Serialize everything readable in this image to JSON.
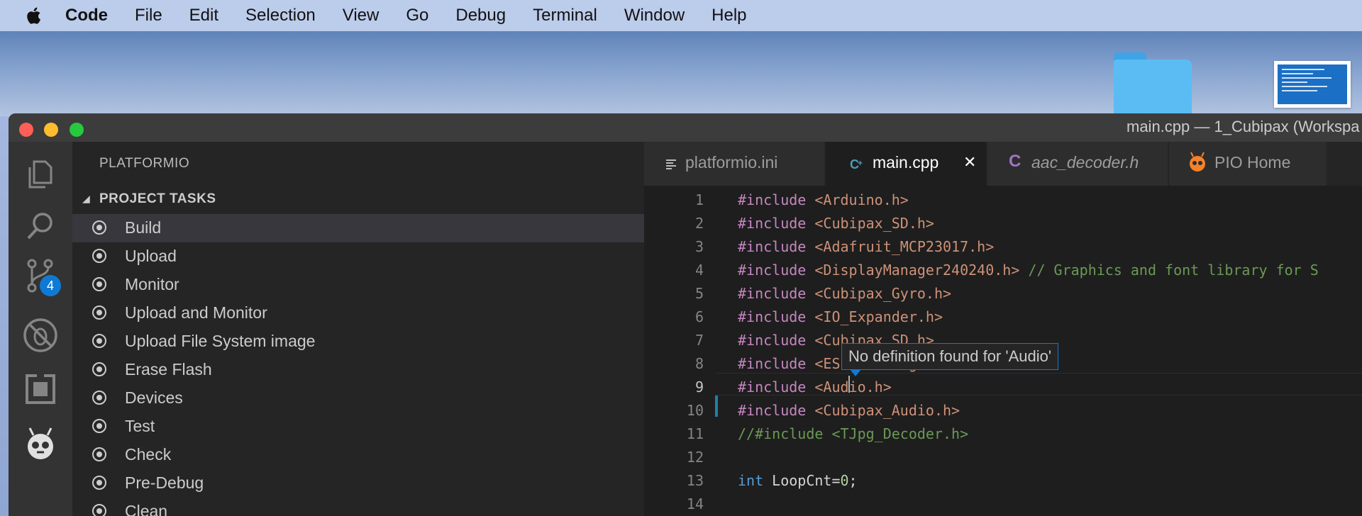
{
  "menubar": {
    "app": "Code",
    "items": [
      "File",
      "Edit",
      "Selection",
      "View",
      "Go",
      "Debug",
      "Terminal",
      "Window",
      "Help"
    ]
  },
  "window": {
    "title": "main.cpp — 1_Cubipax (Workspa"
  },
  "activity": {
    "scm_badge": "4",
    "icons": [
      "files-icon",
      "search-icon",
      "source-control-icon",
      "debug-disabled-icon",
      "extensions-icon",
      "platformio-icon"
    ]
  },
  "sidebar": {
    "title": "PLATFORMIO",
    "section": "PROJECT TASKS",
    "tasks": [
      "Build",
      "Upload",
      "Monitor",
      "Upload and Monitor",
      "Upload File System image",
      "Erase Flash",
      "Devices",
      "Test",
      "Check",
      "Pre-Debug",
      "Clean"
    ]
  },
  "tabs": [
    {
      "label": "platformio.ini",
      "icon": "lines-icon"
    },
    {
      "label": "main.cpp",
      "icon": "cpp-icon",
      "close": "✕"
    },
    {
      "label": "aac_decoder.h",
      "icon": "c-icon"
    },
    {
      "label": "PIO Home",
      "icon": "platformio-icon"
    }
  ],
  "editor": {
    "line_numbers": [
      "1",
      "2",
      "3",
      "4",
      "5",
      "6",
      "7",
      "8",
      "9",
      "10",
      "11",
      "12",
      "13",
      "14"
    ],
    "lines": [
      [
        {
          "c": "kw",
          "t": "#include "
        },
        {
          "c": "str",
          "t": "<Arduino.h>"
        }
      ],
      [
        {
          "c": "kw",
          "t": "#include "
        },
        {
          "c": "str",
          "t": "<Cubipax_SD.h>"
        }
      ],
      [
        {
          "c": "kw",
          "t": "#include "
        },
        {
          "c": "str",
          "t": "<Adafruit_MCP23017.h>"
        }
      ],
      [
        {
          "c": "kw",
          "t": "#include "
        },
        {
          "c": "str",
          "t": "<DisplayManager240240.h>"
        },
        {
          "c": "cm",
          "t": " // Graphics and font library for S"
        }
      ],
      [
        {
          "c": "kw",
          "t": "#include "
        },
        {
          "c": "str",
          "t": "<Cubipax_Gyro.h>"
        }
      ],
      [
        {
          "c": "kw",
          "t": "#include "
        },
        {
          "c": "str",
          "t": "<IO_Expander.h>"
        }
      ],
      [
        {
          "c": "kw",
          "t": "#include "
        },
        {
          "c": "str",
          "t": "<Cubipax_SD.h>"
        }
      ],
      [
        {
          "c": "kw",
          "t": "#include "
        },
        {
          "c": "str",
          "t": "<ESP32AnalogRead.h>"
        }
      ],
      [
        {
          "c": "kw",
          "t": "#include "
        },
        {
          "c": "str",
          "t": "<Audio.h>"
        }
      ],
      [
        {
          "c": "kw",
          "t": "#include "
        },
        {
          "c": "str",
          "t": "<Cubipax_Audio.h>"
        }
      ],
      [
        {
          "c": "cm",
          "t": "//#include <TJpg_Decoder.h>"
        }
      ],
      [],
      [
        {
          "c": "ty",
          "t": "int"
        },
        {
          "c": "",
          "t": " LoopCnt="
        },
        {
          "c": "num",
          "t": "0"
        },
        {
          "c": "",
          "t": ";"
        }
      ],
      []
    ],
    "current_line": 9,
    "tooltip": "No definition found for 'Audio'"
  }
}
